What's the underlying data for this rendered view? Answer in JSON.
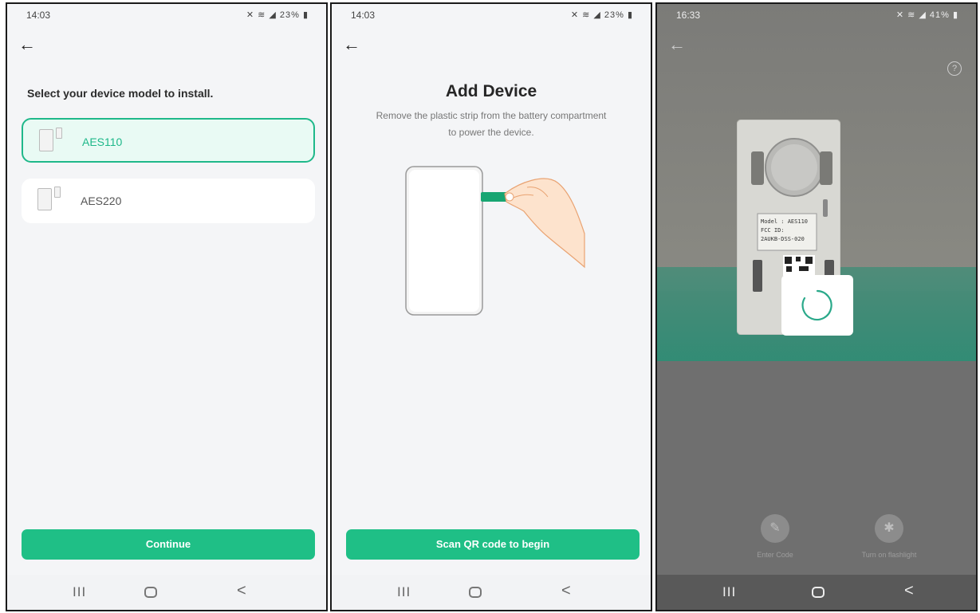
{
  "screen1": {
    "status": {
      "time": "14:03",
      "icons": "✕ ≋ ◢ 23% ▮"
    },
    "prompt": "Select your device model to install.",
    "devices": [
      {
        "label": "AES110",
        "selected": true
      },
      {
        "label": "AES220",
        "selected": false
      }
    ],
    "continue_label": "Continue",
    "nav": {
      "menu": "III",
      "back": "<"
    }
  },
  "screen2": {
    "status": {
      "time": "14:03",
      "icons": "✕ ≋ ◢ 23% ▮"
    },
    "title": "Add Device",
    "subtitle": "Remove the plastic strip from the battery compartment to power the device.",
    "scan_label": "Scan QR code to begin",
    "nav": {
      "menu": "III",
      "back": "<"
    }
  },
  "screen3": {
    "status": {
      "time": "16:33",
      "icons": "✕ ≋ ◢ 41% ▮"
    },
    "help_symbol": "?",
    "device_label_lines": [
      "Model : AES110",
      "FCC ID:",
      "2AUKB-DSS-020"
    ],
    "controls": [
      {
        "label": "Enter Code",
        "icon": "edit-icon"
      },
      {
        "label": "Turn on flashlight",
        "icon": "flashlight-off-icon"
      }
    ],
    "nav": {
      "menu": "III",
      "back": "<"
    }
  },
  "colors": {
    "accent": "#1fbf86",
    "selected_border": "#1fb88a",
    "selected_bg": "#e9faf4"
  }
}
